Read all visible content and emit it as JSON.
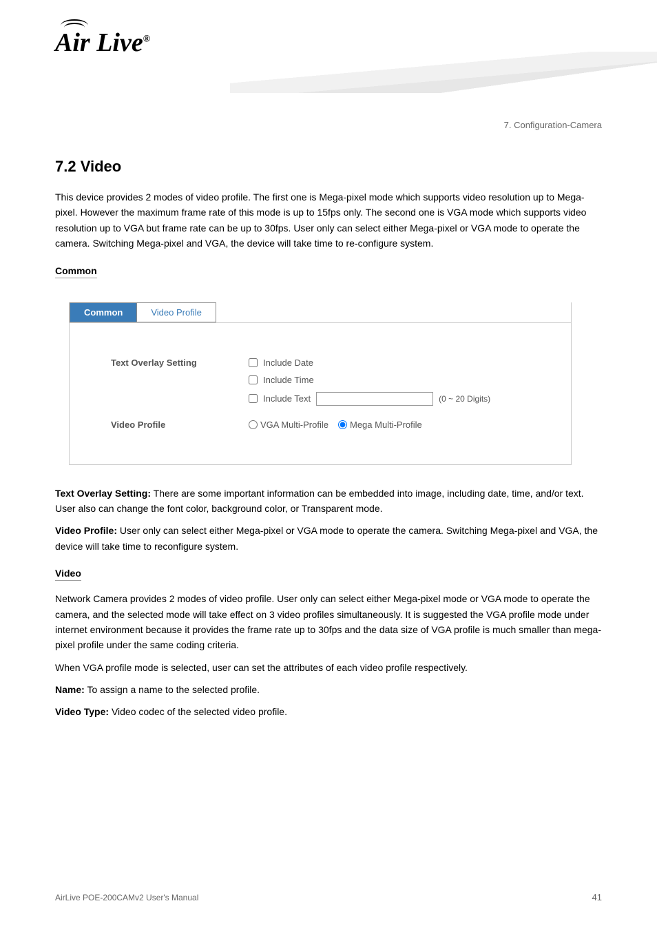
{
  "logo": {
    "text": "Air Live",
    "reg": "®"
  },
  "chapter_ref": "7. Configuration-Camera",
  "section": {
    "number": "7.2",
    "title": "Video"
  },
  "intro_text": "This device provides 2 modes of video profile. The first one is Mega-pixel mode which supports video resolution up to Mega-pixel. However the maximum frame rate of this mode is up to 15fps only. The second one is VGA mode which supports video resolution up to VGA but frame rate can be up to 30fps. User only can select either Mega-pixel or VGA mode to operate the camera. Switching Mega-pixel and VGA, the device will take time to re-configure system.",
  "subsection_common": "Common",
  "settings": {
    "tabs": {
      "common": "Common",
      "video_profile": "Video Profile"
    },
    "text_overlay": {
      "label": "Text Overlay Setting",
      "include_date": "Include Date",
      "include_time": "Include Time",
      "include_text": "Include Text",
      "text_hint": "(0 ~ 20 Digits)"
    },
    "video_profile_row": {
      "label": "Video Profile",
      "vga": "VGA Multi-Profile",
      "mega": "Mega Multi-Profile"
    }
  },
  "text_overlay_desc": {
    "title": "Text Overlay Setting:",
    "body": "There are some important information can be embedded into image, including date, time, and/or text. User also can change the font color, background color, or Transparent mode."
  },
  "video_profile_desc": {
    "title": "Video Profile:",
    "body": "User only can select either Mega-pixel or VGA mode to operate the camera. Switching Mega-pixel and VGA, the device will take time to reconfigure system."
  },
  "subsection_video": "Video",
  "video_body": {
    "para1": "Network Camera provides 2 modes of video profile. User only can select either Mega-pixel mode or VGA mode to operate the camera, and the selected mode will take effect on 3 video profiles simultaneously. It is suggested the VGA profile mode under internet environment because it provides the frame rate up to 30fps and the data size of VGA profile is much smaller than mega-pixel profile under the same coding criteria.",
    "para2": "When VGA profile mode is selected, user can set the attributes of each video profile respectively.",
    "name_label": "Name:",
    "name_body": "To assign a name to the selected profile.",
    "video_type_label": "Video Type:",
    "video_type_body": "Video codec of the selected video profile."
  },
  "footer_left": "AirLive POE-200CAMv2 User's Manual",
  "footer_right": "41"
}
